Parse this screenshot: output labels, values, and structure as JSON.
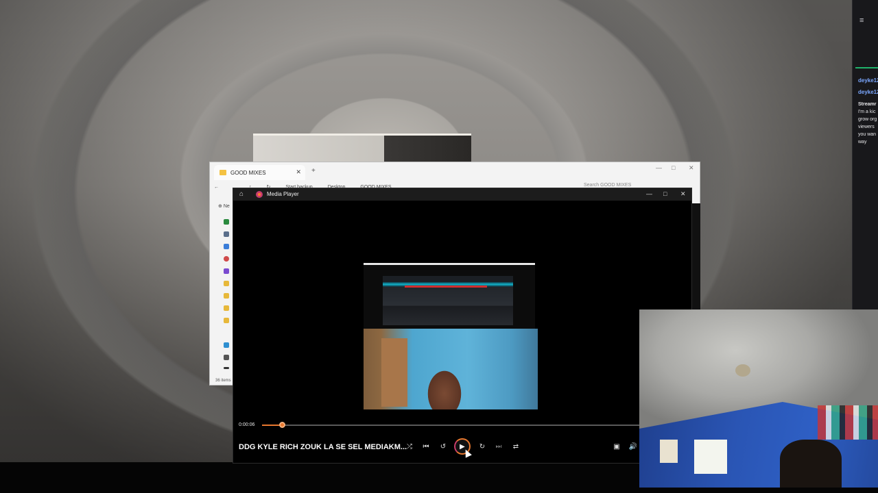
{
  "chat": {
    "messages": [
      {
        "user": "deyke12",
        "text": ""
      },
      {
        "user": "deyke12",
        "text": ""
      }
    ],
    "promo_lines": [
      "Streamr",
      "I'm a kic",
      "grow org",
      "viewers",
      "you wan",
      "way"
    ]
  },
  "explorer": {
    "tab_title": "GOOD MIXES",
    "breadcrumb": [
      "Start backup",
      "Desktop",
      "GOOD MIXES"
    ],
    "search_placeholder": "Search GOOD MIXES",
    "item_count": "36 items",
    "new_label": "Ne"
  },
  "player": {
    "app_title": "Media Player",
    "elapsed": "0:00:06",
    "progress_fraction": 0.052,
    "song_title": "DDG KYLE RICH ZOUK LA SE SEL MEDIAKM...",
    "accent_color": "#e9782f",
    "icons": {
      "home": "home-icon",
      "shuffle": "shuffle-icon",
      "previous": "skip-previous-icon",
      "rewind": "rewind-10-icon",
      "play": "play-icon",
      "forward": "forward-30-icon",
      "next": "skip-next-icon",
      "repeat": "repeat-icon",
      "miniplayer": "miniplayer-icon",
      "volume": "volume-icon"
    }
  }
}
